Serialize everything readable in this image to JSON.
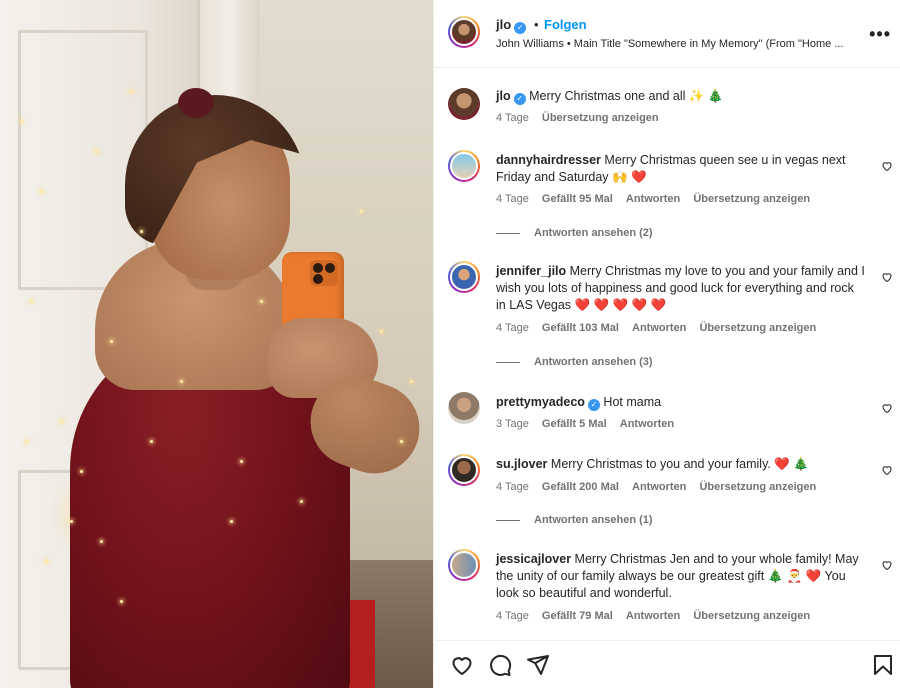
{
  "header": {
    "username": "jlo",
    "dot": "•",
    "follow_label": "Folgen",
    "audio": "John Williams • Main Title \"Somewhere in My Memory\" (From \"Home ...",
    "more_label": "•••"
  },
  "caption": {
    "username": "jlo",
    "text": "Merry Christmas one and all ✨ 🎄",
    "age": "4 Tage",
    "translate": "Übersetzung anzeigen"
  },
  "comments": [
    {
      "username": "dannyhairdresser",
      "text": "Merry Christmas queen see u in vegas next Friday and Saturday 🙌 ❤️",
      "age": "4 Tage",
      "likes": "Gefällt 95 Mal",
      "reply": "Antworten",
      "translate": "Übersetzung anzeigen",
      "replies": "Antworten ansehen (2)"
    },
    {
      "username": "jennifer_jilo",
      "text": "Merry Christmas my love to you and your family and I wish you lots of happiness and good luck for everything and rock in LAS Vegas ❤️ ❤️ ❤️ ❤️ ❤️",
      "age": "4 Tage",
      "likes": "Gefällt 103 Mal",
      "reply": "Antworten",
      "translate": "Übersetzung anzeigen",
      "replies": "Antworten ansehen (3)"
    },
    {
      "username": "prettymyadeco",
      "text": "Hot mama",
      "age": "3 Tage",
      "likes": "Gefällt 5 Mal",
      "reply": "Antworten"
    },
    {
      "username": "su.jlover",
      "text": "Merry Christmas to you and your family. ❤️ 🎄",
      "age": "4 Tage",
      "likes": "Gefällt 200 Mal",
      "reply": "Antworten",
      "translate": "Übersetzung anzeigen",
      "replies": "Antworten ansehen (1)"
    },
    {
      "username": "jessicajlover",
      "text": "Merry Christmas Jen and to your whole family! May the unity of our family always be our greatest gift 🎄 🎅 ❤️ You look so beautiful and wonderful.",
      "age": "4 Tage",
      "likes": "Gefällt 79 Mal",
      "reply": "Antworten",
      "translate": "Übersetzung anzeigen"
    }
  ],
  "icons": {
    "like": "heart-icon",
    "comment": "comment-icon",
    "share": "share-icon",
    "save": "bookmark-icon"
  },
  "colors": {
    "accent": "#0095f6",
    "verified": "#3897f0",
    "muted": "#737373"
  }
}
